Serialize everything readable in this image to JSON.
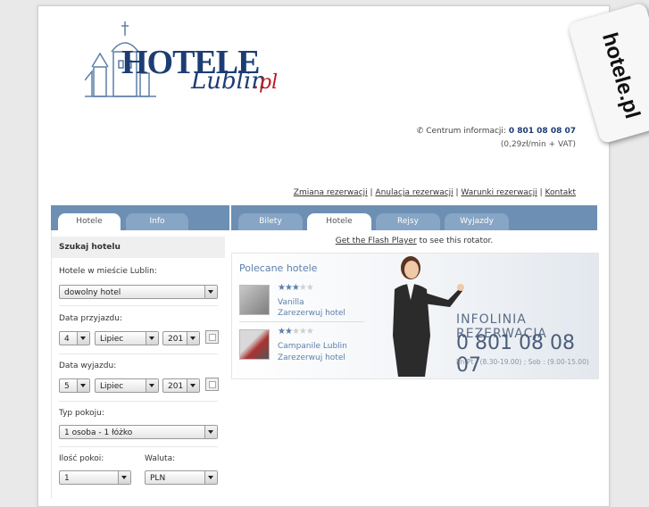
{
  "logo": {
    "main": "HOTELE",
    "city": "Lublin",
    "tld": ".pl"
  },
  "tag": {
    "text": "hotele.pl"
  },
  "info": {
    "label": "Centrum informacji:",
    "phone": "0 801 08 08 07",
    "rate": "(0,29zł/min + VAT)"
  },
  "toplinks": [
    "Zmiana rezerwacji",
    "Anulacja rezerwacji",
    "Warunki rezerwacji",
    "Kontakt"
  ],
  "left_tabs": [
    "Hotele",
    "Info"
  ],
  "right_tabs": [
    "Bilety",
    "Hotele",
    "Rejsy",
    "Wyjazdy"
  ],
  "search": {
    "header": "Szukaj hotelu",
    "city_label": "Hotele w mieście Lublin:",
    "hotel_value": "dowolny hotel",
    "arrival_label": "Data przyjazdu:",
    "arrival": {
      "day": "4",
      "month": "Lipiec",
      "year": "201"
    },
    "departure_label": "Data wyjazdu:",
    "departure": {
      "day": "5",
      "month": "Lipiec",
      "year": "201"
    },
    "room_type_label": "Typ pokoju:",
    "room_type_value": "1 osoba - 1 łóżko",
    "rooms_label": "Ilość pokoi:",
    "rooms_value": "1",
    "currency_label": "Waluta:",
    "currency_value": "PLN"
  },
  "flash": {
    "link": "Get the Flash Player",
    "rest": " to see this rotator."
  },
  "banner": {
    "title": "Polecane hotele",
    "hotels": [
      {
        "name": "Vanilla",
        "stars": 3,
        "reserve": "Zarezerwuj hotel"
      },
      {
        "name": "Campanile Lublin",
        "stars": 2,
        "reserve": "Zarezerwuj hotel"
      }
    ],
    "infoline_title": "INFOLINIA REZERWACJA",
    "infoline_number": "0 801 08 08 07",
    "infoline_hours": "Pn-Pt : (8.30-19.00) ;  Sob : (9.00-15.00)"
  },
  "colors": {
    "brand": "#1c3d73",
    "accent": "#c01b1b",
    "tabbar": "#6d8fb3",
    "link": "#5d7fa8"
  }
}
